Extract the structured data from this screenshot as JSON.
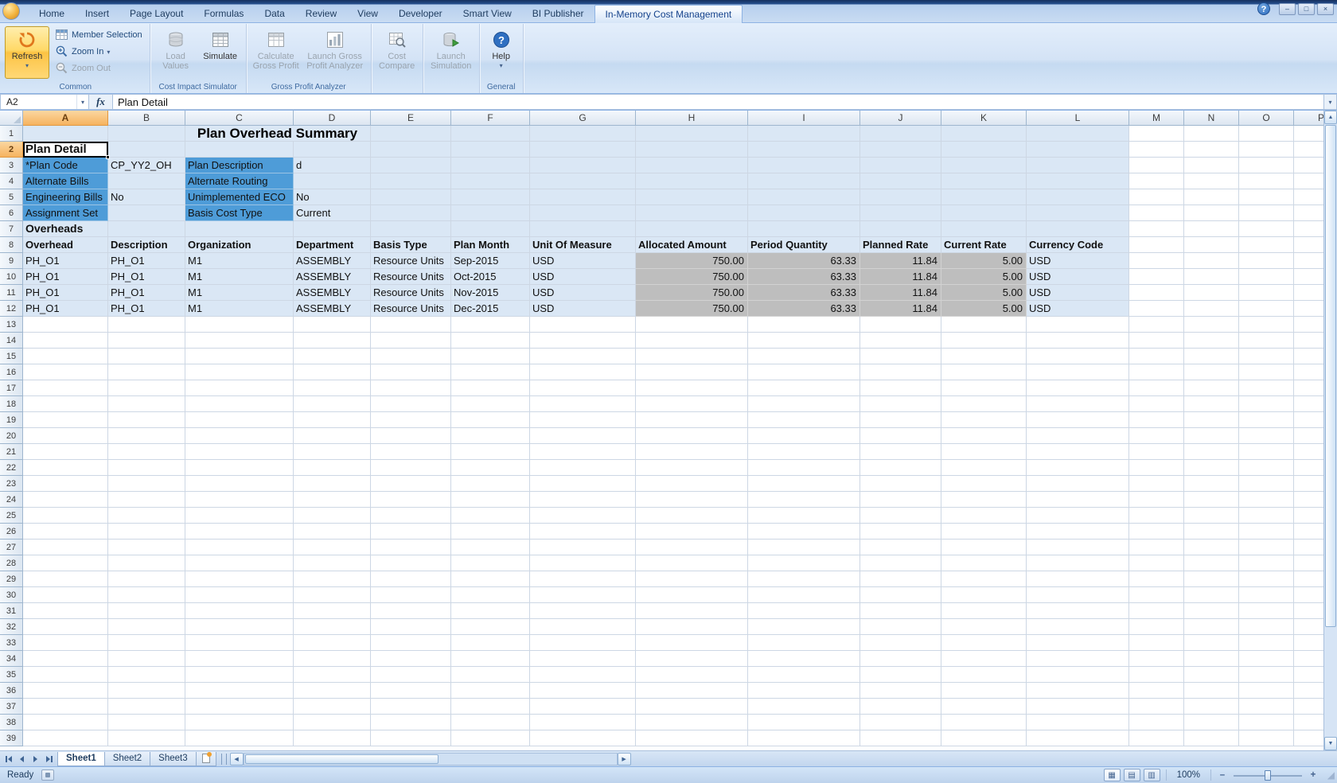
{
  "titlebar": {
    "tabs": [
      {
        "label": "Home",
        "active": false
      },
      {
        "label": "Insert",
        "active": false
      },
      {
        "label": "Page Layout",
        "active": false
      },
      {
        "label": "Formulas",
        "active": false
      },
      {
        "label": "Data",
        "active": false
      },
      {
        "label": "Review",
        "active": false
      },
      {
        "label": "View",
        "active": false
      },
      {
        "label": "Developer",
        "active": false
      },
      {
        "label": "Smart View",
        "active": false
      },
      {
        "label": "BI Publisher",
        "active": false
      },
      {
        "label": "In-Memory Cost Management",
        "active": true
      }
    ],
    "window_controls": {
      "help": "?",
      "minimize": "–",
      "maximize": "□",
      "close": "×"
    }
  },
  "ribbon": {
    "groups": {
      "common": {
        "label": "Common",
        "refresh": "Refresh",
        "member_selection": "Member Selection",
        "zoom_in": "Zoom In",
        "zoom_out": "Zoom Out"
      },
      "cost_impact_simulator": {
        "label": "Cost Impact Simulator",
        "load_values": "Load Values",
        "simulate": "Simulate"
      },
      "gross_profit_analyzer": {
        "label": "Gross Profit Analyzer",
        "calculate_gross_profit": "Calculate Gross Profit",
        "launch_gross_profit_analyzer": "Launch Gross Profit Analyzer"
      },
      "cost_compare_group": {
        "label": "",
        "cost_compare": "Cost Compare"
      },
      "launch_simulation_group": {
        "label": "",
        "launch_simulation": "Launch Simulation"
      },
      "general": {
        "label": "General",
        "help": "Help"
      }
    }
  },
  "formula_bar": {
    "name_box": "A2",
    "fx_label": "fx",
    "content": "Plan Detail"
  },
  "grid": {
    "col_headers": [
      "A",
      "B",
      "C",
      "D",
      "E",
      "F",
      "G",
      "H",
      "I",
      "J",
      "K",
      "L",
      "M",
      "N",
      "O",
      "P"
    ],
    "row_count": 39,
    "selected_cell": {
      "ref": "A2",
      "col": "A",
      "row": 2
    },
    "title": {
      "row": 1,
      "col": "C",
      "span": 2,
      "text": "Plan Overhead Summary"
    },
    "cells": [
      {
        "r": 2,
        "c": "A",
        "text": "Plan Detail",
        "cls": "plan-detail"
      },
      {
        "r": 3,
        "c": "A",
        "text": "*Plan Code",
        "cls": "lbl"
      },
      {
        "r": 3,
        "c": "B",
        "text": "CP_YY2_OH"
      },
      {
        "r": 3,
        "c": "C",
        "text": "Plan Description",
        "cls": "lbl"
      },
      {
        "r": 3,
        "c": "D",
        "text": "d"
      },
      {
        "r": 4,
        "c": "A",
        "text": "Alternate Bills",
        "cls": "lbl"
      },
      {
        "r": 4,
        "c": "C",
        "text": "Alternate Routing",
        "cls": "lbl"
      },
      {
        "r": 5,
        "c": "A",
        "text": "Engineering Bills",
        "cls": "lbl"
      },
      {
        "r": 5,
        "c": "B",
        "text": "No"
      },
      {
        "r": 5,
        "c": "C",
        "text": "Unimplemented ECO",
        "cls": "lbl"
      },
      {
        "r": 5,
        "c": "D",
        "text": "No"
      },
      {
        "r": 6,
        "c": "A",
        "text": "Assignment Set",
        "cls": "lbl"
      },
      {
        "r": 6,
        "c": "C",
        "text": "Basis Cost Type",
        "cls": "lbl"
      },
      {
        "r": 6,
        "c": "D",
        "text": "Current"
      },
      {
        "r": 7,
        "c": "A",
        "text": "Overheads",
        "cls": "section"
      }
    ],
    "overhead_table": {
      "header_row": 8,
      "first_data_row": 9,
      "headers": [
        "Overhead",
        "Description",
        "Organization",
        "Department",
        "Basis Type",
        "Plan Month",
        "Unit Of Measure",
        "Allocated Amount",
        "Period Quantity",
        "Planned Rate",
        "Current Rate",
        "Currency Code"
      ],
      "gray_numeric_columns": [
        7,
        8,
        9,
        10
      ],
      "rows": [
        [
          "PH_O1",
          "PH_O1",
          "M1",
          "ASSEMBLY",
          "Resource Units",
          "Sep-2015",
          "USD",
          "750.00",
          "63.33",
          "11.84",
          "5.00",
          "USD"
        ],
        [
          "PH_O1",
          "PH_O1",
          "M1",
          "ASSEMBLY",
          "Resource Units",
          "Oct-2015",
          "USD",
          "750.00",
          "63.33",
          "11.84",
          "5.00",
          "USD"
        ],
        [
          "PH_O1",
          "PH_O1",
          "M1",
          "ASSEMBLY",
          "Resource Units",
          "Nov-2015",
          "USD",
          "750.00",
          "63.33",
          "11.84",
          "5.00",
          "USD"
        ],
        [
          "PH_O1",
          "PH_O1",
          "M1",
          "ASSEMBLY",
          "Resource Units",
          "Dec-2015",
          "USD",
          "750.00",
          "63.33",
          "11.84",
          "5.00",
          "USD"
        ]
      ]
    }
  },
  "sheet_bar": {
    "tabs": [
      {
        "label": "Sheet1",
        "active": true
      },
      {
        "label": "Sheet2",
        "active": false
      },
      {
        "label": "Sheet3",
        "active": false
      }
    ]
  },
  "status_bar": {
    "mode": "Ready",
    "zoom": "100%"
  },
  "icons": {
    "dropdown": "▾",
    "scroll_up": "▲",
    "scroll_down": "▼",
    "scroll_left": "◀",
    "scroll_right": "▶",
    "formula_expand": "▾",
    "grip": "◢",
    "view_normal": "▦",
    "view_page_layout": "▤",
    "view_page_break": "▥",
    "zoom_minus": "–",
    "zoom_plus": "+"
  },
  "colors": {
    "selected_header_orange": "#F6B35F",
    "cell_light_blue": "#DAE7F5",
    "cell_label_blue": "#4E9CD8",
    "cell_gray": "#BEBEBE",
    "active_tab_text": "#15428B"
  }
}
